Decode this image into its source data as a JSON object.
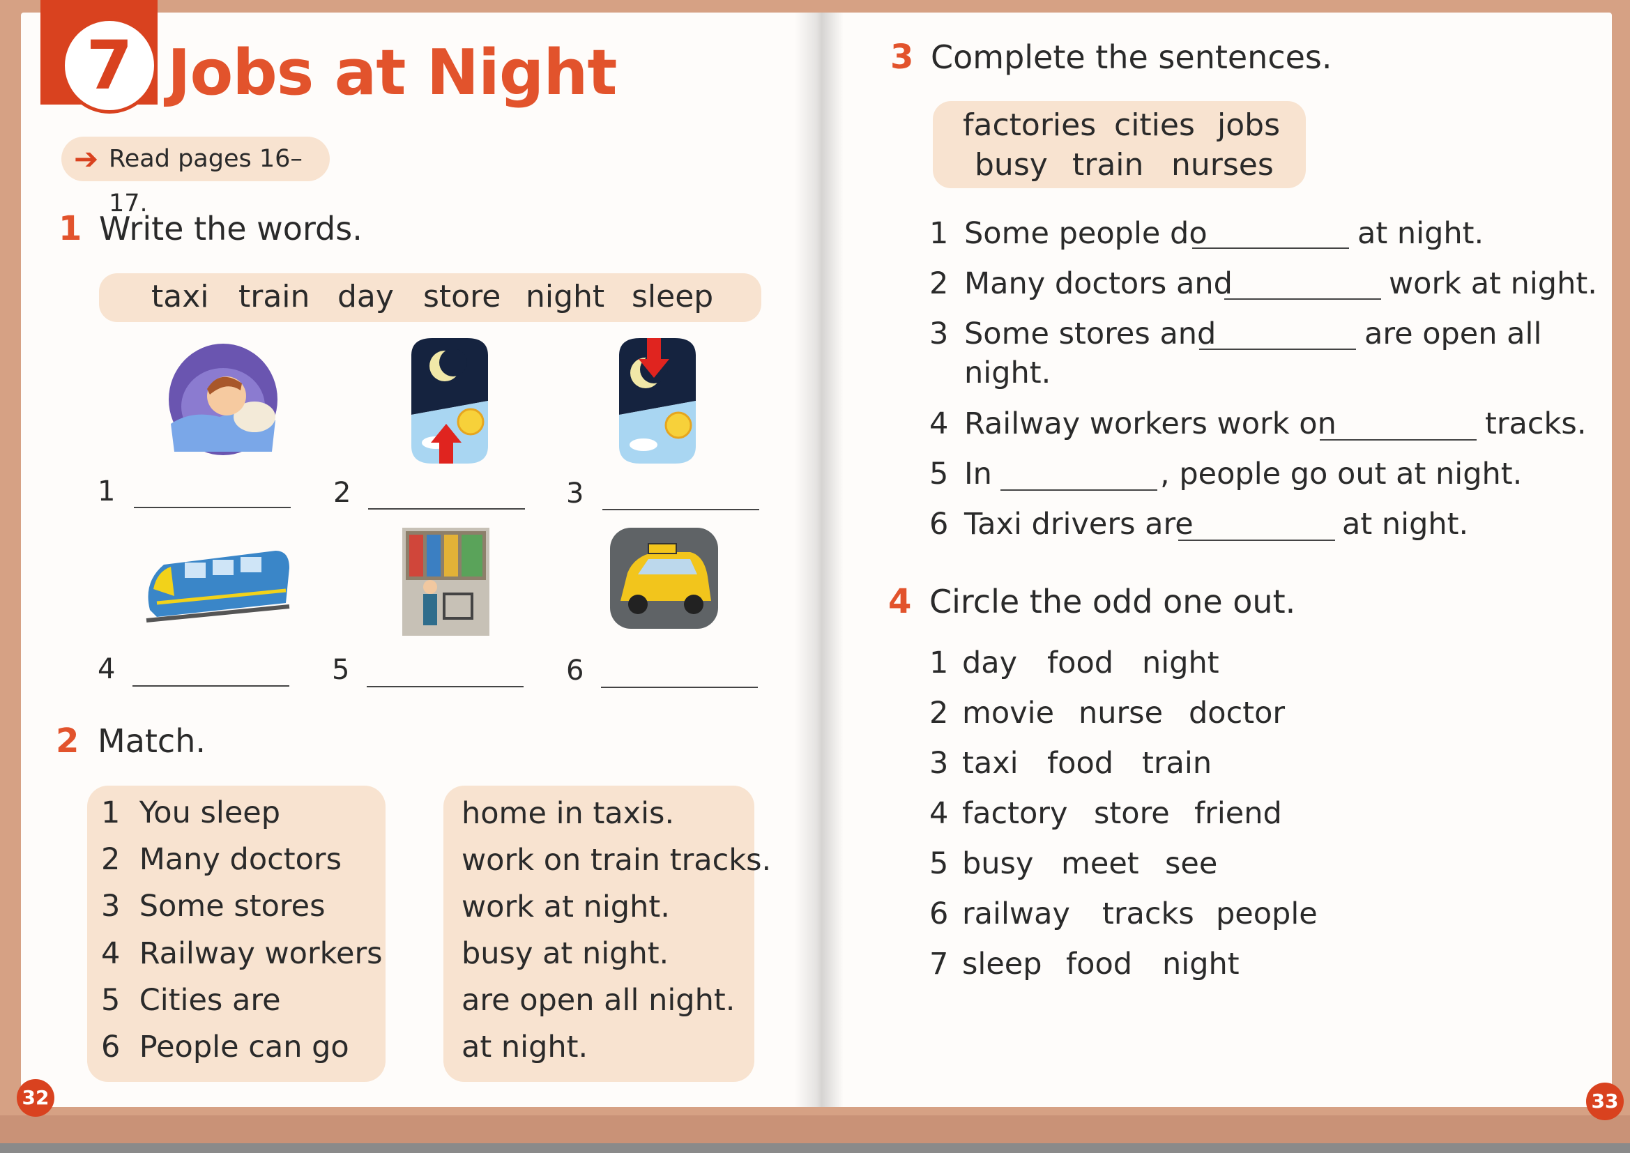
{
  "unit": {
    "number": "7",
    "title": "Jobs at Night",
    "read_pages": "Read pages 16–17."
  },
  "ex1": {
    "number": "1",
    "instruction": "Write the words.",
    "word_bank": [
      "taxi",
      "train",
      "day",
      "store",
      "night",
      "sleep"
    ],
    "items": [
      {
        "n": "1",
        "picture": "sleeping-person-icon"
      },
      {
        "n": "2",
        "picture": "night-to-day-icon"
      },
      {
        "n": "3",
        "picture": "day-to-night-icon"
      },
      {
        "n": "4",
        "picture": "train-icon"
      },
      {
        "n": "5",
        "picture": "store-icon"
      },
      {
        "n": "6",
        "picture": "taxi-icon"
      }
    ]
  },
  "ex2": {
    "number": "2",
    "instruction": "Match.",
    "left": [
      {
        "n": "1",
        "text": "You sleep"
      },
      {
        "n": "2",
        "text": "Many doctors"
      },
      {
        "n": "3",
        "text": "Some stores"
      },
      {
        "n": "4",
        "text": "Railway workers"
      },
      {
        "n": "5",
        "text": "Cities are"
      },
      {
        "n": "6",
        "text": "People can go"
      }
    ],
    "right": [
      "home in taxis.",
      "work on train tracks.",
      "work at night.",
      "busy at night.",
      "are open all night.",
      "at night."
    ]
  },
  "ex3": {
    "number": "3",
    "instruction": "Complete the sentences.",
    "word_bank_row1": [
      "factories",
      "cities",
      "jobs"
    ],
    "word_bank_row2": [
      "busy",
      "train",
      "nurses"
    ],
    "items": [
      {
        "n": "1",
        "before": "Some people do",
        "after": "at night."
      },
      {
        "n": "2",
        "before": "Many doctors and",
        "after": "work at night."
      },
      {
        "n": "3",
        "before": "Some stores and",
        "after": "are open all",
        "cont": "night."
      },
      {
        "n": "4",
        "before": "Railway workers work on",
        "after": "tracks."
      },
      {
        "n": "5",
        "before": "In",
        "after": ", people go out at night."
      },
      {
        "n": "6",
        "before": "Taxi drivers are",
        "after": "at night."
      }
    ]
  },
  "ex4": {
    "number": "4",
    "instruction": "Circle the odd one out.",
    "items": [
      {
        "n": "1",
        "words": [
          "day",
          "food",
          "night"
        ]
      },
      {
        "n": "2",
        "words": [
          "movie",
          "nurse",
          "doctor"
        ]
      },
      {
        "n": "3",
        "words": [
          "taxi",
          "food",
          "train"
        ]
      },
      {
        "n": "4",
        "words": [
          "factory",
          "store",
          "friend"
        ]
      },
      {
        "n": "5",
        "words": [
          "busy",
          "meet",
          "see"
        ]
      },
      {
        "n": "6",
        "words": [
          "railway",
          "tracks",
          "people"
        ]
      },
      {
        "n": "7",
        "words": [
          "sleep",
          "food",
          "night"
        ]
      }
    ]
  },
  "pages": {
    "left": "32",
    "right": "33"
  },
  "colors": {
    "accent": "#e2532c",
    "box": "#f8e3d0",
    "paper": "#fefcfa"
  }
}
